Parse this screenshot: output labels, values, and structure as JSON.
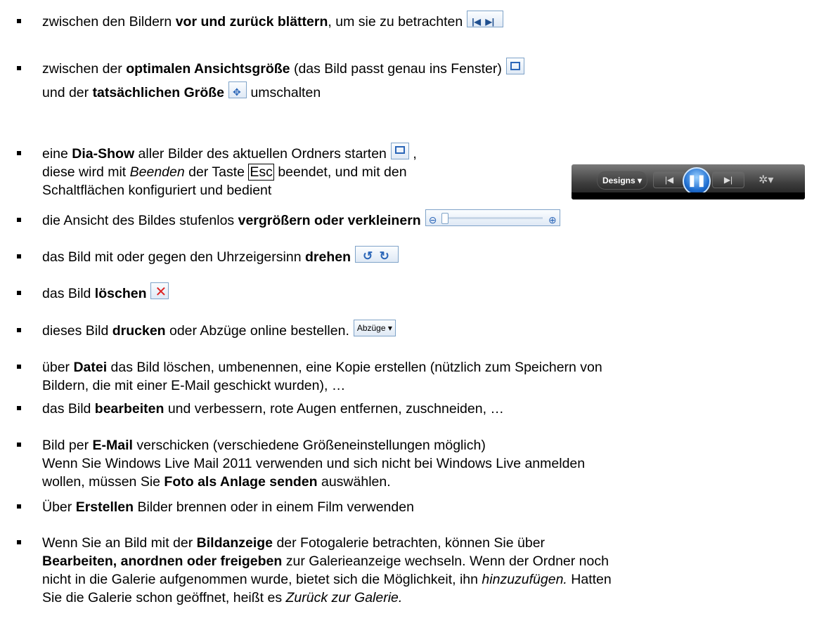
{
  "items": [
    {
      "lines": [
        [
          {
            "t": "zwischen den Bildern "
          },
          {
            "t": "vor und zurück blättern",
            "b": true
          },
          {
            "t": ", um sie zu betrachten"
          }
        ]
      ],
      "icon": "prev-next-icon"
    },
    {
      "lines": [
        [
          {
            "t": "zwischen der "
          },
          {
            "t": "optimalen Ansichtsgröße",
            "b": true
          },
          {
            "t": " (das Bild passt genau ins Fenster)"
          }
        ],
        [
          {
            "t": "und der "
          },
          {
            "t": "tatsächlichen Größe",
            "b": true
          },
          {
            "t": " umschalten"
          }
        ]
      ],
      "icons": [
        "fit-to-window-icon",
        "actual-size-icon"
      ]
    },
    {
      "lines": [
        [
          {
            "t": "eine "
          },
          {
            "t": "Dia-Show",
            "b": true
          },
          {
            "t": " aller Bilder des aktuellen Ordners starten"
          },
          {
            "t": " ,"
          }
        ],
        [
          {
            "t": "diese wird mit "
          },
          {
            "t": "Beenden",
            "i": true
          },
          {
            "t": " der Taste "
          },
          {
            "t": "Esc",
            "key": true
          },
          {
            "t": " beendet, und mit den"
          }
        ],
        [
          {
            "t": "Schaltflächen konfiguriert und bedient"
          }
        ]
      ],
      "icon": "slideshow-icon",
      "slideshow_bar": {
        "designs_label": "Designs ▾"
      }
    },
    {
      "lines": [
        [
          {
            "t": "die Ansicht des Bildes stufenlos "
          },
          {
            "t": "vergrößern oder verkleinern",
            "b": true
          }
        ]
      ],
      "icon": "zoom-slider-icon"
    },
    {
      "lines": [
        [
          {
            "t": "das Bild mit oder gegen den Uhrzeigersinn "
          },
          {
            "t": "drehen",
            "b": true
          }
        ]
      ],
      "icon": "rotate-icon"
    },
    {
      "lines": [
        [
          {
            "t": "das Bild "
          },
          {
            "t": "löschen",
            "b": true
          }
        ]
      ],
      "icon": "delete-icon"
    },
    {
      "lines": [
        [
          {
            "t": "dieses Bild "
          },
          {
            "t": "drucken",
            "b": true
          },
          {
            "t": "  oder Abzüge online bestellen."
          }
        ]
      ],
      "icon": "prints-dropdown-icon",
      "prints_label": "Abzüge"
    },
    {
      "lines": [
        [
          {
            "t": "über "
          },
          {
            "t": "Datei",
            "b": true
          },
          {
            "t": " das Bild löschen, umbenennen, eine Kopie erstellen (nützlich zum Speichern von"
          }
        ],
        [
          {
            "t": "Bildern, die mit einer E-Mail geschickt wurden), …"
          }
        ]
      ]
    },
    {
      "lines": [
        [
          {
            "t": "das Bild "
          },
          {
            "t": "bearbeiten",
            "b": true
          },
          {
            "t": " und verbessern, rote Augen entfernen, zuschneiden, …"
          }
        ]
      ]
    },
    {
      "lines": [
        [
          {
            "t": "Bild per "
          },
          {
            "t": "E-Mail",
            "b": true
          },
          {
            "t": " verschicken (verschiedene Größeneinstellungen möglich)"
          }
        ],
        [
          {
            "t": "Wenn Sie Windows Live Mail 2011 verwenden und sich nicht bei Windows Live anmelden"
          }
        ],
        [
          {
            "t": "wollen, müssen Sie "
          },
          {
            "t": "Foto als Anlage senden",
            "b": true
          },
          {
            "t": " auswählen."
          }
        ]
      ]
    },
    {
      "lines": [
        [
          {
            "t": "Über "
          },
          {
            "t": "Erstellen",
            "b": true
          },
          {
            "t": " Bilder brennen oder in einem Film verwenden"
          }
        ]
      ]
    },
    {
      "lines": [
        [
          {
            "t": "Wenn Sie an Bild mit der "
          },
          {
            "t": "Bildanzeige",
            "b": true
          },
          {
            "t": " der Fotogalerie betrachten, können Sie über"
          }
        ],
        [
          {
            "t": "Bearbeiten, anordnen oder freigeben",
            "b": true
          },
          {
            "t": " zur Galerieanzeige wechseln. Wenn der Ordner noch"
          }
        ],
        [
          {
            "t": "nicht in die Galerie aufgenommen wurde, bietet sich die Möglichkeit, ihn "
          },
          {
            "t": "hinzuzufügen.",
            "i": true
          },
          {
            "t": " Hatten"
          }
        ],
        [
          {
            "t": "Sie die Galerie schon geöffnet, heißt es "
          },
          {
            "t": "Zurück zur Galerie.",
            "i": true
          }
        ]
      ]
    }
  ]
}
